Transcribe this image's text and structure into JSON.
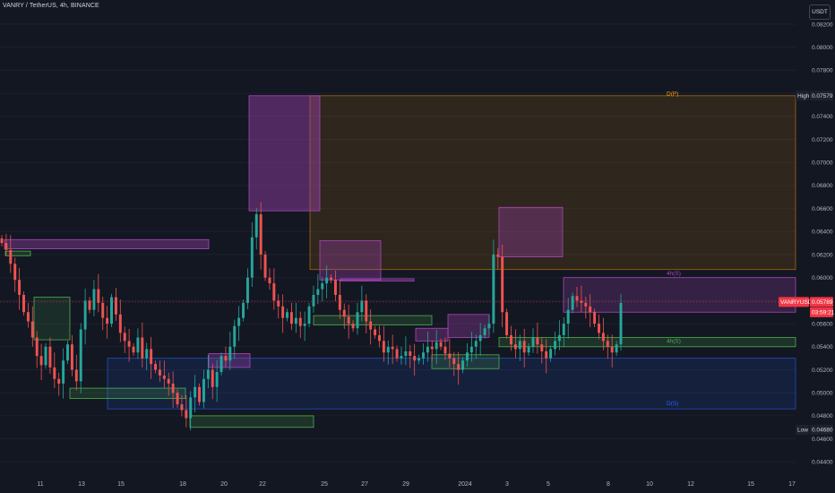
{
  "header": {
    "symbol_title": "VANRY / TetherUS, 4h, BINANCE",
    "currency_button": "USDT"
  },
  "colors": {
    "background": "#131722",
    "up_candle": "#26a69a",
    "down_candle": "#ef5350",
    "supply_zone": "#ab47bc",
    "demand_zone": "#4caf50",
    "range_box": "#ff9800",
    "range_low_box": "#2962ff",
    "last_price_line": "#f23645"
  },
  "chart_data": {
    "type": "candlestick",
    "interval": "4h",
    "exchange": "BINANCE",
    "ylim": [
      0.0435,
      0.0825
    ],
    "y_ticks": [
      "0.08200",
      "0.08000",
      "0.07800",
      "0.07600",
      "0.07400",
      "0.07200",
      "0.07000",
      "0.06800",
      "0.06600",
      "0.06400",
      "0.06200",
      "0.06000",
      "0.05800",
      "0.05600",
      "0.05400",
      "0.05200",
      "0.05000",
      "0.04800",
      "0.04600",
      "0.04400"
    ],
    "x_ticks": [
      "11",
      "13",
      "15",
      "18",
      "20",
      "22",
      "25",
      "27",
      "29",
      "2024",
      "3",
      "5",
      "8",
      "10",
      "12",
      "15",
      "17"
    ],
    "levels": {
      "high_label": "High",
      "high_value": "0.07579",
      "low_label": "Low",
      "low_value": "0.04680",
      "last_label": "VANRYUSDT",
      "last_value": "0.05789",
      "countdown": "03:59:21"
    },
    "zone_labels": [
      "D(P)",
      "4h(S)",
      "4h(S)",
      "D(S)"
    ],
    "closes": [
      0.063,
      0.0624,
      0.0612,
      0.0598,
      0.0585,
      0.057,
      0.0562,
      0.0548,
      0.0532,
      0.0524,
      0.054,
      0.0522,
      0.0512,
      0.0508,
      0.0528,
      0.0542,
      0.052,
      0.051,
      0.0555,
      0.058,
      0.0572,
      0.059,
      0.0578,
      0.0565,
      0.056,
      0.0583,
      0.0568,
      0.0552,
      0.0545,
      0.054,
      0.0535,
      0.0548,
      0.053,
      0.0538,
      0.0525,
      0.052,
      0.0515,
      0.0512,
      0.0508,
      0.05,
      0.049,
      0.0485,
      0.0478,
      0.0496,
      0.0505,
      0.0492,
      0.0512,
      0.052,
      0.0505,
      0.0518,
      0.0532,
      0.0528,
      0.054,
      0.0558,
      0.0565,
      0.0578,
      0.06,
      0.0635,
      0.0655,
      0.062,
      0.06,
      0.0595,
      0.058,
      0.0575,
      0.0565,
      0.057,
      0.056,
      0.0565,
      0.0558,
      0.056,
      0.0575,
      0.0585,
      0.059,
      0.0595,
      0.06,
      0.0598,
      0.0585,
      0.0572,
      0.0566,
      0.056,
      0.0556,
      0.057,
      0.058,
      0.0562,
      0.0555,
      0.055,
      0.0545,
      0.0535,
      0.054,
      0.0538,
      0.053,
      0.0532,
      0.0536,
      0.0532,
      0.0528,
      0.053,
      0.0535,
      0.054,
      0.0538,
      0.0544,
      0.054,
      0.0534,
      0.053,
      0.0525,
      0.052,
      0.0528,
      0.0535,
      0.054,
      0.0545,
      0.055,
      0.0556,
      0.056,
      0.062,
      0.0618,
      0.057,
      0.055,
      0.0542,
      0.0538,
      0.0545,
      0.0535,
      0.054,
      0.0548,
      0.0542,
      0.0536,
      0.053,
      0.0538,
      0.0545,
      0.055,
      0.056,
      0.0572,
      0.0584,
      0.058,
      0.0578,
      0.0575,
      0.057,
      0.056,
      0.0552,
      0.0545,
      0.054,
      0.0535,
      0.0542,
      0.0578
    ]
  }
}
